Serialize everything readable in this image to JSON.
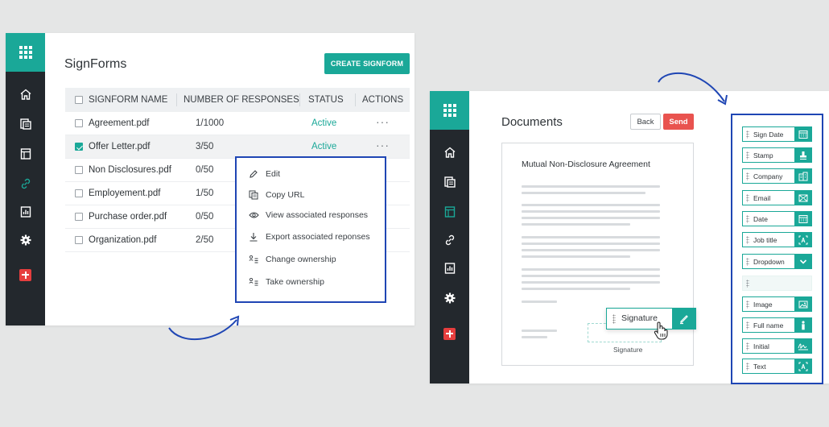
{
  "panel1": {
    "title": "SignForms",
    "create_button": "CREATE SIGNFORM",
    "sidebar": [
      "apps-icon",
      "home-icon",
      "documents-icon",
      "templates-icon",
      "link-icon",
      "reports-icon",
      "settings-icon",
      "add-icon"
    ],
    "columns": [
      "SIGNFORM NAME",
      "NUMBER OF RESPONSES",
      "STATUS",
      "ACTIONS"
    ],
    "rows": [
      {
        "name": "Agreement.pdf",
        "responses": "1/1000",
        "status": "Active",
        "actions": "···",
        "checked": false
      },
      {
        "name": "Offer Letter.pdf",
        "responses": "3/50",
        "status": "Active",
        "actions": "···",
        "checked": true
      },
      {
        "name": "Non Disclosures.pdf",
        "responses": "0/50",
        "status": "",
        "actions": "",
        "checked": false
      },
      {
        "name": "Employement.pdf",
        "responses": "1/50",
        "status": "",
        "actions": "",
        "checked": false
      },
      {
        "name": "Purchase order.pdf",
        "responses": "0/50",
        "status": "",
        "actions": "",
        "checked": false
      },
      {
        "name": "Organization.pdf",
        "responses": "2/50",
        "status": "",
        "actions": "",
        "checked": false
      }
    ],
    "menu": [
      {
        "label": "Edit",
        "icon": "pencil-icon"
      },
      {
        "label": "Copy URL",
        "icon": "copy-icon"
      },
      {
        "label": "View associated responses",
        "icon": "eye-icon"
      },
      {
        "label": "Export associated reponses",
        "icon": "download-icon"
      },
      {
        "label": "Change ownership",
        "icon": "ownership-icon"
      },
      {
        "label": "Take ownership",
        "icon": "ownership-icon"
      }
    ]
  },
  "panel2": {
    "title": "Documents",
    "back_button": "Back",
    "send_button": "Send",
    "document_title": "Mutual Non-Disclosure Agreement",
    "signature_chip": "Signature",
    "signature_label": "Signature",
    "fields": [
      {
        "label": "Sign Date",
        "icon": "calendar-icon"
      },
      {
        "label": "Stamp",
        "icon": "stamp-icon"
      },
      {
        "label": "Company",
        "icon": "building-icon"
      },
      {
        "label": "Email",
        "icon": "mail-icon"
      },
      {
        "label": "Date",
        "icon": "calendar-icon"
      },
      {
        "label": "Job title",
        "icon": "text-field-icon"
      },
      {
        "label": "Dropdown",
        "icon": "chevron-down-icon"
      },
      {
        "label": "",
        "icon": ""
      },
      {
        "label": "Image",
        "icon": "image-icon"
      },
      {
        "label": "Full name",
        "icon": "person-icon"
      },
      {
        "label": "Initial",
        "icon": "signature-icon"
      },
      {
        "label": "Text",
        "icon": "text-field-icon"
      }
    ]
  },
  "colors": {
    "accent": "#1aa898",
    "sidebar": "#23282d",
    "send": "#e9534f",
    "highlight_border": "#1f46b4",
    "add": "#e63e3e"
  }
}
